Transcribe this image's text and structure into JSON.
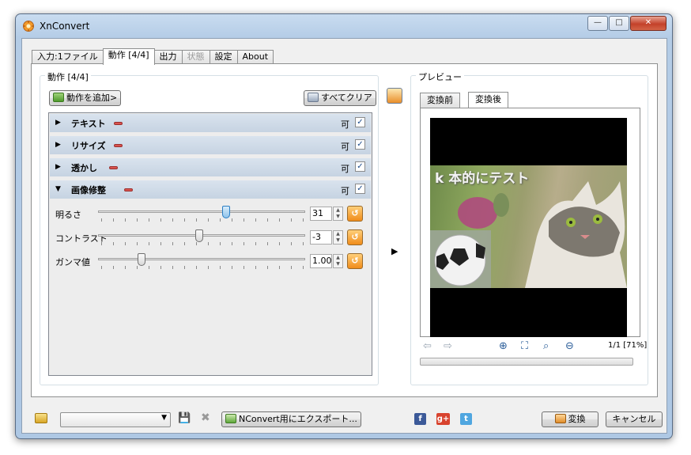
{
  "window": {
    "title": "XnConvert",
    "minimize": "—",
    "maximize": "□",
    "close": "✕"
  },
  "tabs": [
    {
      "label": "入力:1ファイル",
      "active": false
    },
    {
      "label": "動作 [4/4]",
      "active": true
    },
    {
      "label": "出力",
      "active": false
    },
    {
      "label": "状態",
      "active": false,
      "disabled": true
    },
    {
      "label": "設定",
      "active": false
    },
    {
      "label": "About",
      "active": false
    }
  ],
  "actions_group": {
    "title": "動作 [4/4]",
    "add_button": "動作を追加>",
    "clear_button": "すべてクリア",
    "operations": [
      {
        "name": "テキスト",
        "enabled_label": "可",
        "checked": true,
        "expanded": false
      },
      {
        "name": "リサイズ",
        "enabled_label": "可",
        "checked": true,
        "expanded": false
      },
      {
        "name": "透かし",
        "enabled_label": "可",
        "checked": true,
        "expanded": false
      },
      {
        "name": "画像修整",
        "enabled_label": "可",
        "checked": true,
        "expanded": true
      }
    ],
    "sliders": [
      {
        "label": "明るさ",
        "value": "31",
        "level": 0.62,
        "active": true
      },
      {
        "label": "コントラスト",
        "value": "-3",
        "level": 0.49,
        "active": false
      },
      {
        "label": "ガンマ値",
        "value": "1.00",
        "level": 0.21,
        "active": false
      }
    ]
  },
  "preview": {
    "title": "プレビュー",
    "tab_before": "変換前",
    "tab_after": "変換後",
    "overlay_text": "k 本的にテスト",
    "page_info": "1/1 [71%]"
  },
  "bottom": {
    "export_button": "NConvert用にエクスポート...",
    "convert_button": "変換",
    "cancel_button": "キャンセル",
    "social": {
      "facebook": "f",
      "google": "g+",
      "twitter": "t"
    }
  },
  "colors": {
    "accent": "#2a7dc3",
    "row_header": "#c6d3e2",
    "minus": "#d9534f",
    "reset": "#f08c1a"
  }
}
